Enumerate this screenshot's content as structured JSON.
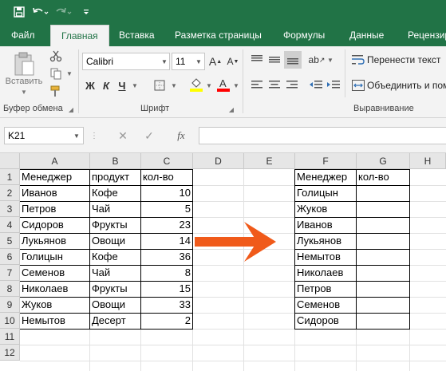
{
  "quick_access": {
    "save_icon": "save-icon",
    "undo_icon": "undo-icon",
    "redo_icon": "redo-icon",
    "customize_icon": "chevron-down-icon"
  },
  "tabs": [
    {
      "label": "Файл",
      "active": false
    },
    {
      "label": "Главная",
      "active": true
    },
    {
      "label": "Вставка",
      "active": false
    },
    {
      "label": "Разметка страницы",
      "active": false
    },
    {
      "label": "Формулы",
      "active": false
    },
    {
      "label": "Данные",
      "active": false
    },
    {
      "label": "Рецензир",
      "active": false
    }
  ],
  "ribbon": {
    "clipboard": {
      "paste_label": "Вставить",
      "group_label": "Буфер обмена"
    },
    "font": {
      "name": "Calibri",
      "size": "11",
      "bold": "Ж",
      "italic": "К",
      "underline": "Ч",
      "group_label": "Шрифт",
      "fill_color": "#ffff00",
      "font_color": "#ff0000"
    },
    "alignment": {
      "wrap_label": "Перенести текст",
      "merge_label": "Объединить и пом",
      "group_label": "Выравнивание"
    }
  },
  "formula_bar": {
    "name_box": "K21",
    "fx": "fx",
    "value": ""
  },
  "grid": {
    "columns": [
      "A",
      "B",
      "C",
      "D",
      "E",
      "F",
      "G",
      "H"
    ],
    "rows": [
      "1",
      "2",
      "3",
      "4",
      "5",
      "6",
      "7",
      "8",
      "9",
      "10",
      "11",
      "12"
    ],
    "left_table": {
      "headers": [
        "Менеджер",
        "продукт",
        "кол-во"
      ],
      "rows": [
        [
          "Иванов",
          "Кофе",
          "10"
        ],
        [
          "Петров",
          "Чай",
          "5"
        ],
        [
          "Сидоров",
          "Фрукты",
          "23"
        ],
        [
          "Лукьянов",
          "Овощи",
          "14"
        ],
        [
          "Голицын",
          "Кофе",
          "36"
        ],
        [
          "Семенов",
          "Чай",
          "8"
        ],
        [
          "Николаев",
          "Фрукты",
          "15"
        ],
        [
          "Жуков",
          "Овощи",
          "33"
        ],
        [
          "Немытов",
          "Десерт",
          "2"
        ]
      ]
    },
    "right_table": {
      "headers": [
        "Менеджер",
        "кол-во"
      ],
      "rows": [
        "Голицын",
        "Жуков",
        "Иванов",
        "Лукьянов",
        "Немытов",
        "Николаев",
        "Петров",
        "Семенов",
        "Сидоров"
      ]
    },
    "arrow_color": "#f05a1a"
  }
}
